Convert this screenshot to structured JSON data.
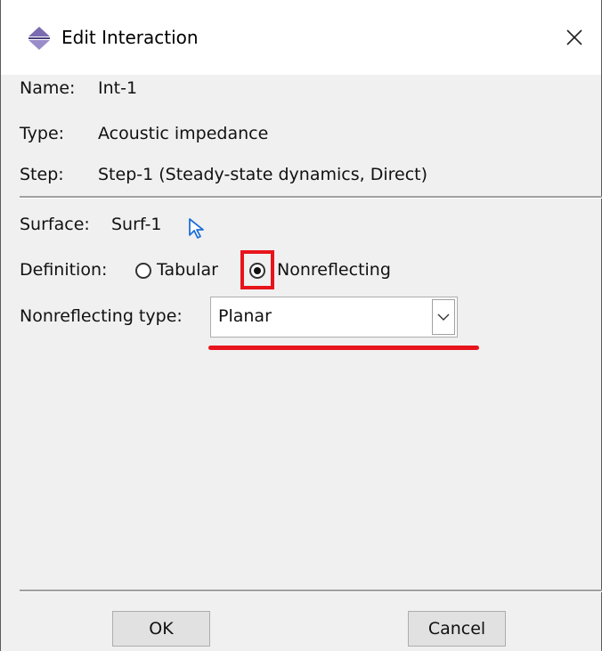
{
  "window": {
    "title": "Edit Interaction",
    "close_icon": "close-icon",
    "app_icon": "interaction-icon"
  },
  "info": {
    "name_label": "Name:",
    "name_value": "Int-1",
    "type_label": "Type:",
    "type_value": "Acoustic impedance",
    "step_label": "Step:",
    "step_value": "Step-1 (Steady-state dynamics, Direct)"
  },
  "surface": {
    "label": "Surface:",
    "value": "Surf-1",
    "select_icon": "pointer-arrow-icon"
  },
  "definition": {
    "label": "Definition:",
    "options": [
      "Tabular",
      "Nonreflecting"
    ],
    "selected": "Nonreflecting"
  },
  "nonreflecting_type": {
    "label": "Nonreflecting type:",
    "value": "Planar"
  },
  "buttons": {
    "ok": "OK",
    "cancel": "Cancel"
  },
  "colors": {
    "annotation_red": "#e8141c",
    "icon_blue": "#1e6fd9",
    "icon_purple": "#7b6bb0"
  }
}
